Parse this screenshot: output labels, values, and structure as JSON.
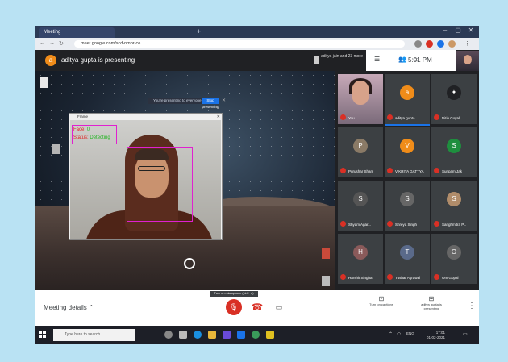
{
  "browser": {
    "tabs": [
      {
        "label": "Meeting"
      },
      {
        "label": ""
      }
    ],
    "url": "meet.google.com/scd-nmbr-ce"
  },
  "meet": {
    "presenter_initial": "a",
    "presenting_text": "aditya gupta is presenting",
    "others_text": "aditya jain and 23 more",
    "time": "5:01 PM",
    "share_banner": "You're presenting to everyone",
    "stop_label": "Stop presenting",
    "bottom": {
      "details_label": "Meeting details",
      "tooltip": "Turn on microphone (ctrl + d)",
      "right_buttons": [
        {
          "label": "Turn on captions",
          "icon": "⊡"
        },
        {
          "label": "aditya gupta is presenting",
          "icon": "⊟"
        }
      ]
    }
  },
  "camera_window": {
    "title": "Frame",
    "status_label": "Face:",
    "status_value": "0",
    "status_label2": "Status:",
    "status_value2": "Detecting"
  },
  "participants": [
    {
      "name": "You",
      "initial": "",
      "color": "#000",
      "photo": true
    },
    {
      "name": "aditya gupta",
      "initial": "a",
      "color": "#f08c19",
      "speaking": true
    },
    {
      "name": "Nitin Goyal",
      "initial": "✦",
      "color": "#202124"
    },
    {
      "name": "Purushar Sham",
      "initial": "P",
      "color": "#8a7a66"
    },
    {
      "name": "VIKRITA GATTYA",
      "initial": "V",
      "color": "#f08c19"
    },
    {
      "name": "Sunpam Jak",
      "initial": "S",
      "color": "#1e8e3e"
    },
    {
      "name": "Shyam Agar...",
      "initial": "S",
      "color": "#555"
    },
    {
      "name": "Shreya Singh",
      "initial": "S",
      "color": "#666"
    },
    {
      "name": "Sanghmitra P...",
      "initial": "S",
      "color": "#b08c6a"
    },
    {
      "name": "Harshit Singha",
      "initial": "H",
      "color": "#8a5a5a"
    },
    {
      "name": "Tushar Agrawal",
      "initial": "T",
      "color": "#5a6a8a"
    },
    {
      "name": "Om Gopal",
      "initial": "O",
      "color": "#666"
    }
  ],
  "taskbar": {
    "search_placeholder": "Type here to search",
    "clock_time": "17:01",
    "clock_date": "01-02-2021",
    "lang": "ENG"
  },
  "colors": {
    "accent": "#1a73e8",
    "end_call": "#d93025",
    "box": "#e020d0"
  }
}
